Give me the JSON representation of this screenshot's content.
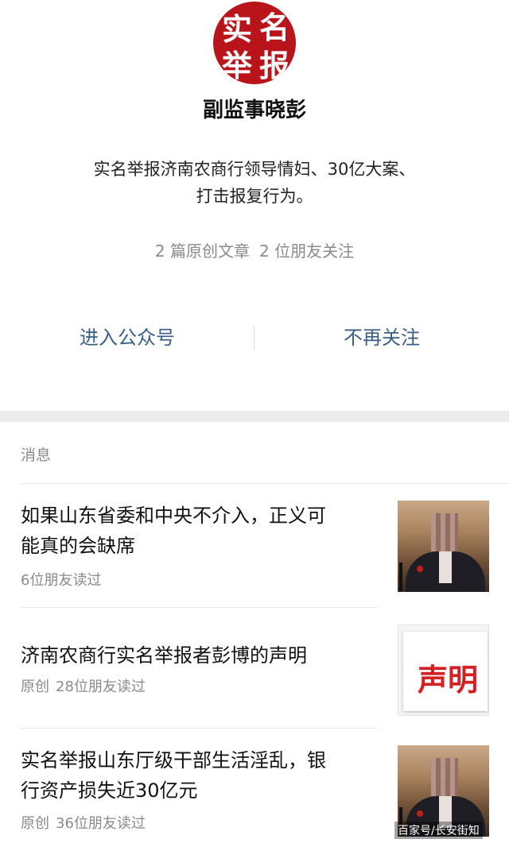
{
  "profile": {
    "avatar_chars": [
      "实",
      "名",
      "举",
      "报"
    ],
    "avatar_color": "#b8141a",
    "account_name": "副监事晓彭",
    "description_line1": "实名举报济南农商行领导情妇、30亿大案、",
    "description_line2": "打击报复行为。",
    "stats": {
      "articles": "2 篇原创文章",
      "friends": "2 位朋友关注"
    },
    "actions": {
      "enter": "进入公众号",
      "unfollow": "不再关注"
    },
    "link_color": "#3a5d86"
  },
  "messages": {
    "header": "消息",
    "items": [
      {
        "title_line1": "如果山东省委和中央不介入，正义可",
        "title_line2": "能真的会缺席",
        "tag": "",
        "reads": "6位朋友读过",
        "thumb": "person-photo"
      },
      {
        "title_line1": "济南农商行实名举报者彭博的声明",
        "title_line2": "",
        "tag": "原创",
        "reads": "28位朋友读过",
        "thumb": "statement-image",
        "thumb_text": "声明"
      },
      {
        "title_line1": "实名举报山东厅级干部生活淫乱，银",
        "title_line2": "行资产损失近30亿元",
        "tag": "原创",
        "reads": "36位朋友读过",
        "thumb": "person-photo"
      }
    ]
  },
  "watermark": "百家号/长安街知"
}
